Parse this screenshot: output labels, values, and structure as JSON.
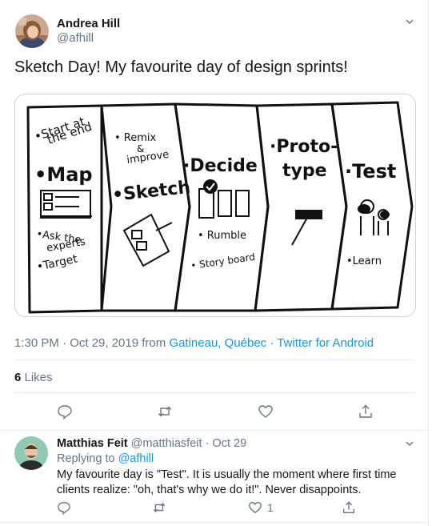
{
  "tweet": {
    "author_name": "Andrea Hill",
    "author_handle": "@afhill",
    "text": "Sketch Day! My favourite day of design sprints!",
    "timestamp": "1:30 PM · Oct 29, 2019 from ",
    "location": "Gatineau, Québec",
    "separator": " · ",
    "source": "Twitter for Android",
    "likes_count": "6",
    "likes_label": " Likes",
    "sketch": {
      "col1": [
        "•Start at",
        "the end",
        "•Map",
        "•Ask the",
        "experts",
        "•Target"
      ],
      "col2": [
        "• Remix",
        "&",
        "improve",
        "•Sketch"
      ],
      "col3": [
        "·Decide",
        "• Rumble",
        "• Story board"
      ],
      "col4": [
        "·Proto-",
        "type"
      ],
      "col5": [
        "·Test",
        "•Learn"
      ]
    }
  },
  "reply": {
    "author_name": "Matthias Feit",
    "author_handle": "@matthiasfeit",
    "dot": " · ",
    "date": "Oct 29",
    "replying_label": "Replying to ",
    "replying_handle": "@afhill",
    "text": "My favourite day is \"Test\". It is usually the moment where first time clients realize: \"oh, that's why we do it!\". Never disappoints.",
    "like_count": "1"
  },
  "icons": [
    "chevron-down-icon",
    "reply-icon",
    "retweet-icon",
    "like-icon",
    "share-icon"
  ],
  "colors": {
    "accent": "#1b95e0",
    "secondary_text": "#657786",
    "border": "#e6ecf0"
  }
}
